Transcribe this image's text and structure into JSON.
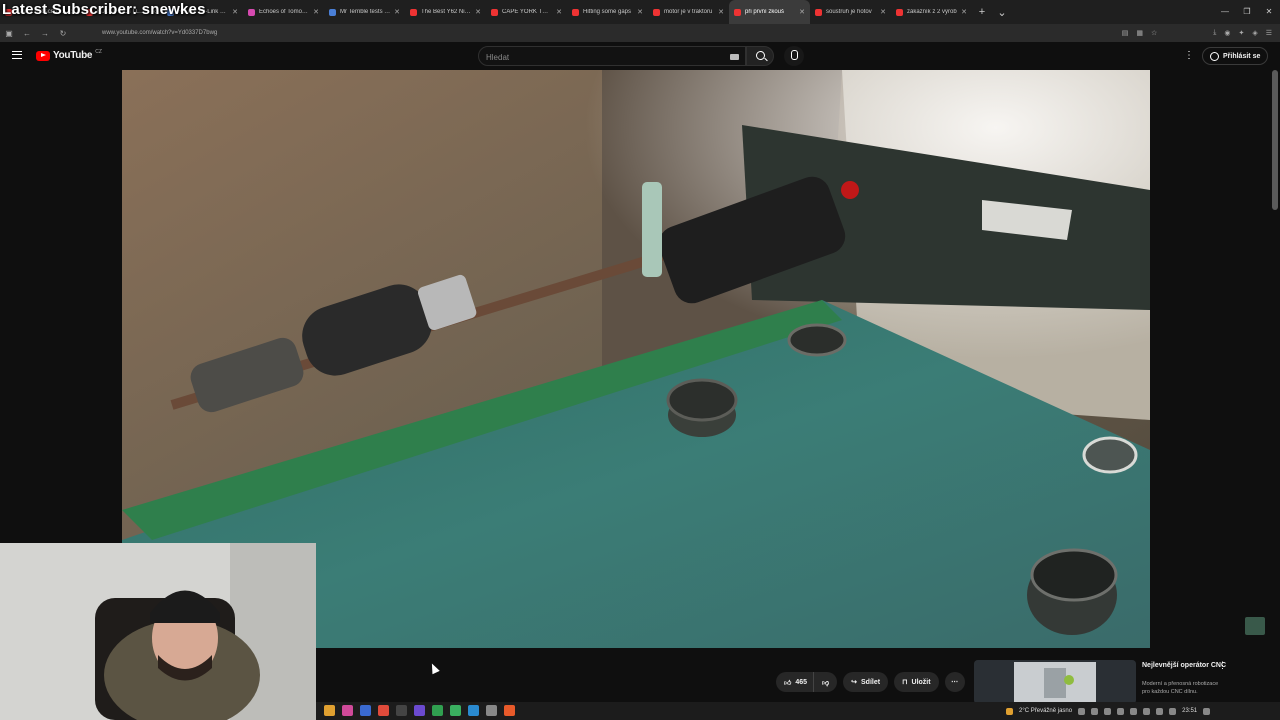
{
  "overlay": {
    "title": "Latest Subscriber: snewkes"
  },
  "browser": {
    "tabs": [
      {
        "label": "Latest Subscriber: snewkes",
        "active": false
      },
      {
        "label": "FULLTHROTTLERIDER",
        "active": false
      },
      {
        "label": "Router TP-Link TL-W",
        "active": false
      },
      {
        "label": "Echoes of Tomorrow",
        "active": false
      },
      {
        "label": "Mr Terrible tests Y6",
        "active": false
      },
      {
        "label": "The Best Y62 Nissan",
        "active": false
      },
      {
        "label": "CAPE YORK TELE TR",
        "active": false
      },
      {
        "label": "Hitting some gaps",
        "active": false
      },
      {
        "label": "motor je v traktoru",
        "active": false
      },
      {
        "label": "při první zkouš",
        "active": true
      },
      {
        "label": "soustruh je hotov",
        "active": false
      },
      {
        "label": "zákazník z 2 výrob",
        "active": false
      }
    ],
    "url": "www.youtube.com/watch?v=Yd0337D7bwg"
  },
  "youtube": {
    "logo_text": "YouTube",
    "country_code": "CZ",
    "search_placeholder": "Hledat",
    "signin_label": "Přihlásit se"
  },
  "actions": {
    "like_count": "465",
    "share_label": "Sdílet",
    "save_label": "Uložit"
  },
  "recommendation": {
    "title": "Nejlevnější operátor CNC",
    "description": "Moderní a přenosná robotizace pro každou CNC dílnu."
  },
  "taskbar": {
    "weather": "2°C  Převážně jasno",
    "time": "23:51"
  }
}
